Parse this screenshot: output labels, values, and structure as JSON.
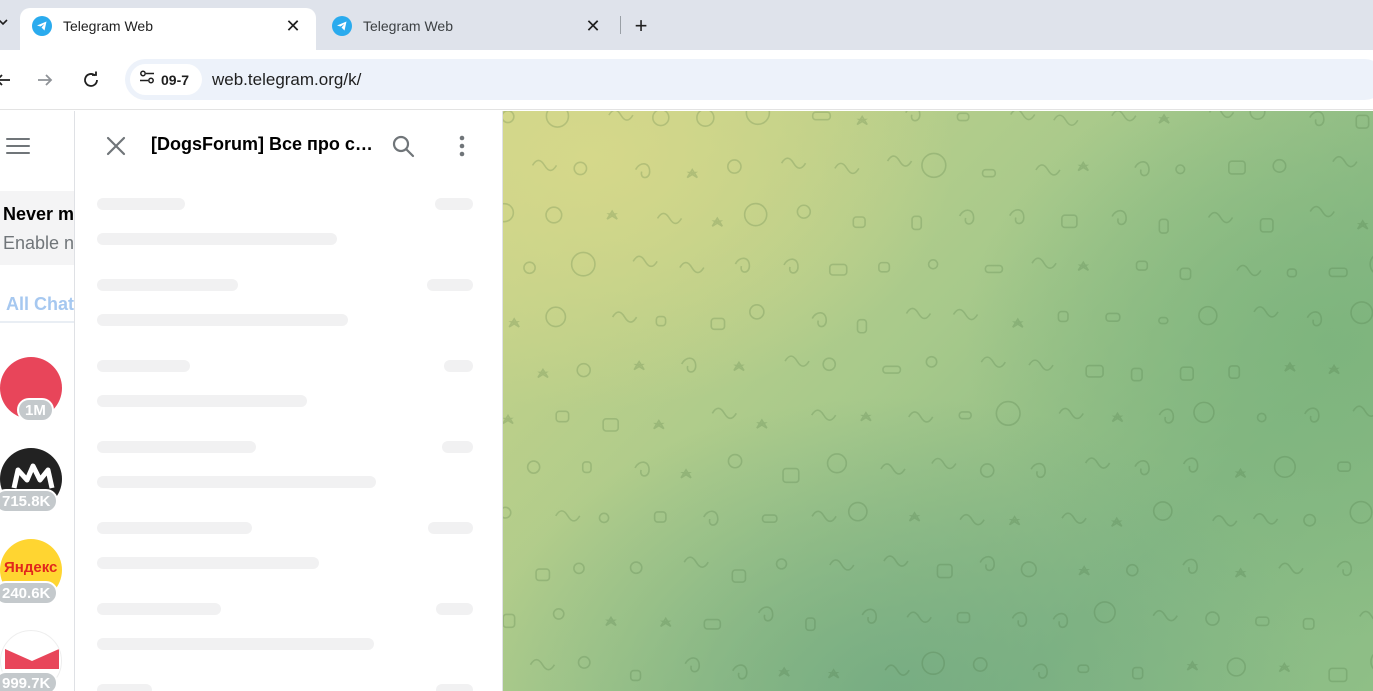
{
  "browser": {
    "tabs": [
      {
        "title": "Telegram Web",
        "active": true
      },
      {
        "title": "Telegram Web",
        "active": false
      }
    ],
    "new_tab_symbol": "+",
    "close_symbol": "✕",
    "site_chip": "09-7",
    "url": "web.telegram.org/k/"
  },
  "sidebar": {
    "notification": {
      "title": "Never m",
      "subtitle": "Enable n"
    },
    "folder_tab": "All Chat",
    "chats": [
      {
        "badge": "1M",
        "avatar_color": "#e8455a"
      },
      {
        "badge": "715.8K",
        "avatar_color": "#222222"
      },
      {
        "badge": "240.6K",
        "avatar_color": "#ffd531",
        "avatar_text": "Яндекс"
      },
      {
        "badge": "999.7K",
        "avatar_color": "#ffffff"
      }
    ]
  },
  "search_panel": {
    "title": "[DogsForum] Все про собак"
  },
  "colors": {
    "accent": "#2aabee",
    "badge": "#c4c9cc",
    "skeleton": "#f1f1f2"
  }
}
